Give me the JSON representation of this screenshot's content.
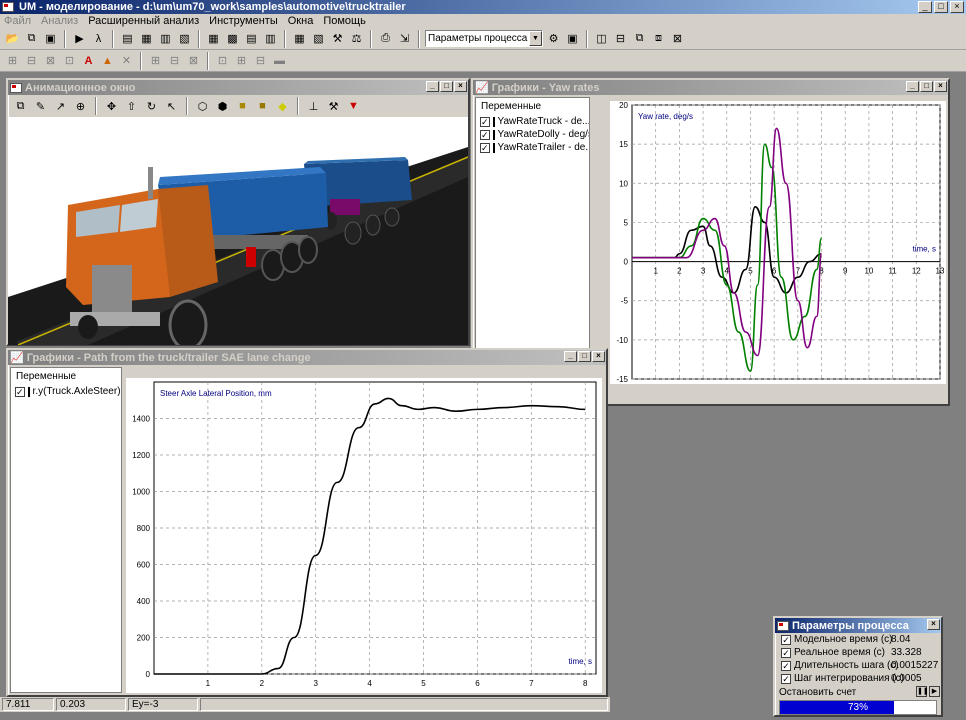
{
  "app": {
    "title": "UM - моделирование - d:\\um\\um70_work\\samples\\automotive\\trucktrailer"
  },
  "menu": [
    "Файл",
    "Анализ",
    "Расширенный анализ",
    "Инструменты",
    "Окна",
    "Помощь"
  ],
  "toolbar": {
    "combo_value": "Параметры процесса"
  },
  "anim_window": {
    "title": "Анимационное окно"
  },
  "yaw_window": {
    "title": "Графики - Yaw rates",
    "vars_header": "Переменные",
    "vars": [
      {
        "label": "YawRateTruck - de...",
        "color": "#000000"
      },
      {
        "label": "YawRateDolly - deg/s",
        "color": "#008000"
      },
      {
        "label": "YawRateTrailer - de...",
        "color": "#800080"
      }
    ]
  },
  "path_window": {
    "title": "Графики - Path from the truck/trailer SAE lane change",
    "vars_header": "Переменные",
    "vars": [
      {
        "label": "r.y(Truck.AxleSteer)...",
        "color": "#000000"
      }
    ]
  },
  "chart_data": [
    {
      "type": "line",
      "title": "Yaw rate, deg/s",
      "xlabel": "time, s",
      "xlim": [
        0,
        13
      ],
      "ylim": [
        -15,
        20
      ],
      "xticks": [
        "1",
        "2",
        "3",
        "4",
        "5",
        "6",
        "7",
        "8",
        "9",
        "10",
        "11",
        "12",
        "13"
      ],
      "yticks": [
        "20",
        "15",
        "10",
        "5",
        "0",
        "-5",
        "-10",
        "-15"
      ],
      "series": [
        {
          "name": "YawRateTruck - deg/s",
          "color": "#000000",
          "x": [
            0,
            1.8,
            2,
            2.5,
            3,
            3.3,
            3.8,
            4.3,
            4.8,
            5.2,
            5.6,
            6,
            6.5,
            7,
            7.5,
            8
          ],
          "y": [
            0.5,
            0.5,
            1,
            4,
            4.5,
            2,
            -2,
            -4,
            -1,
            7,
            5,
            -2,
            -4,
            -2,
            0,
            1
          ]
        },
        {
          "name": "YawRateDolly - deg/s",
          "color": "#008000",
          "x": [
            0,
            2,
            2.5,
            3,
            3.5,
            4,
            4.5,
            5,
            5.3,
            5.6,
            5.9,
            6.3,
            6.8,
            7.3,
            7.8,
            8
          ],
          "y": [
            0.5,
            0.5,
            2,
            5.5,
            4,
            -3,
            -9,
            -14,
            -3,
            15,
            12,
            -2,
            -10,
            -7,
            -1,
            3
          ]
        },
        {
          "name": "YawRateTrailer - deg/s",
          "color": "#800080",
          "x": [
            0,
            2.3,
            3,
            3.5,
            3.9,
            4.3,
            4.8,
            5.3,
            5.8,
            6.1,
            6.5,
            7,
            7.4,
            7.8,
            8
          ],
          "y": [
            0.5,
            0.5,
            4,
            5.5,
            2,
            -4,
            -9,
            -12,
            7,
            17,
            10,
            -5,
            -11,
            -7,
            1
          ]
        }
      ]
    },
    {
      "type": "line",
      "title": "Steer Axle Lateral Position, mm",
      "xlabel": "time, s",
      "xlim": [
        0,
        8.2
      ],
      "ylim": [
        0,
        1600
      ],
      "xticks": [
        "1",
        "2",
        "3",
        "4",
        "5",
        "6",
        "7",
        "8"
      ],
      "yticks": [
        "1400",
        "1200",
        "1000",
        "800",
        "600",
        "400",
        "200",
        "0"
      ],
      "series": [
        {
          "name": "r.y(Truck.AxleSteer)",
          "color": "#000000",
          "x": [
            0,
            2,
            2.3,
            2.6,
            3,
            3.4,
            3.8,
            4.1,
            4.35,
            4.6,
            4.9,
            5.2,
            5.6,
            6,
            6.5,
            7,
            7.5,
            8
          ],
          "y": [
            0,
            0,
            30,
            200,
            650,
            1050,
            1350,
            1480,
            1510,
            1470,
            1450,
            1460,
            1440,
            1450,
            1460,
            1470,
            1465,
            1450
          ]
        }
      ]
    }
  ],
  "process": {
    "title": "Параметры процесса",
    "rows": [
      {
        "label": "Модельное время (с)",
        "value": "8.04"
      },
      {
        "label": "Реальное время (с)",
        "value": "33.328"
      },
      {
        "label": "Длительность шага (с)",
        "value": "0.0015227"
      },
      {
        "label": "Шаг интегрирования (с)",
        "value": "0.0005"
      }
    ],
    "stop_label": "Остановить счет",
    "progress": "73%",
    "progress_value": 0.73
  },
  "status": {
    "a": "7.811",
    "b": "0.203",
    "c": "Ey=-3"
  }
}
